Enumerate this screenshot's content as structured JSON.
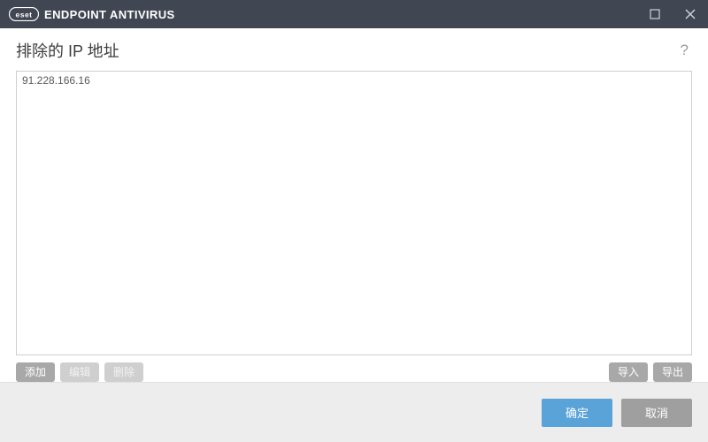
{
  "titlebar": {
    "brand_logo_text": "eset",
    "brand_name": "ENDPOINT ANTIVIRUS"
  },
  "heading": "排除的 IP 地址",
  "help_tooltip": "?",
  "list": {
    "items": [
      "91.228.166.16"
    ]
  },
  "list_actions": {
    "add": "添加",
    "edit": "编辑",
    "delete": "删除",
    "import": "导入",
    "export": "导出"
  },
  "footer": {
    "ok": "确定",
    "cancel": "取消"
  }
}
